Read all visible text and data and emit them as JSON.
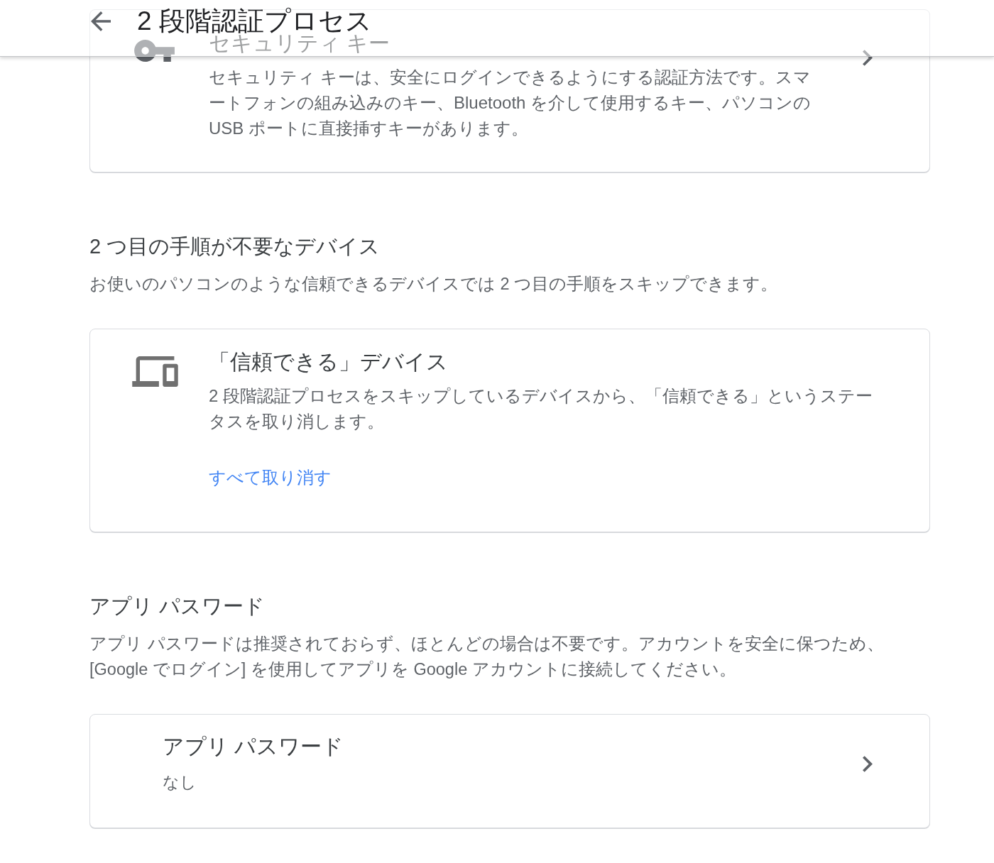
{
  "header": {
    "title": "2 段階認証プロセス"
  },
  "sections": [
    {
      "cards": [
        {
          "kind": "security_key",
          "title": "セキュリティ キー",
          "description": "セキュリティ キーは、安全にログインできるようにする認証方法です。スマートフォンの組み込みのキー、Bluetooth を介して使用するキー、パソコンの USB ポートに直接挿すキーがあります。"
        }
      ]
    },
    {
      "heading": "2 つ目の手順が不要なデバイス",
      "description": "お使いのパソコンのような信頼できるデバイスでは 2 つ目の手順をスキップできます。",
      "cards": [
        {
          "kind": "trusted_devices",
          "title": "「信頼できる」デバイス",
          "description": "2 段階認証プロセスをスキップしているデバイスから、「信頼できる」というステータスを取り消します。",
          "link": "すべて取り消す"
        }
      ]
    },
    {
      "heading": "アプリ パスワード",
      "description": "アプリ パスワードは推奨されておらず、ほとんどの場合は不要です。アカウントを安全に保つため、[Google でログイン] を使用してアプリを Google アカウントに接続してください。",
      "cards": [
        {
          "kind": "app_passwords",
          "title": "アプリ パスワード",
          "value": "なし"
        }
      ]
    }
  ]
}
